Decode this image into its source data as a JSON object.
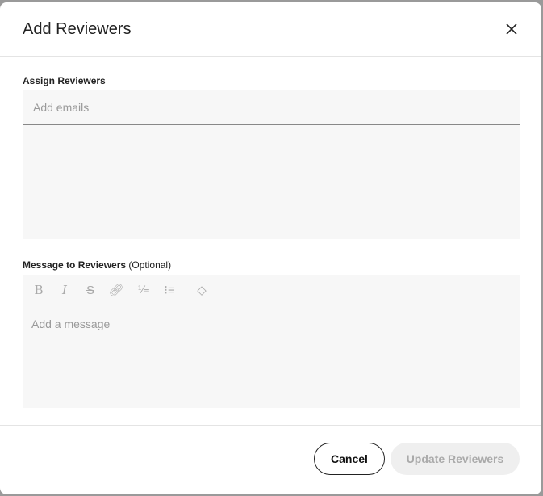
{
  "dialog": {
    "title": "Add Reviewers",
    "close_icon": "close-icon"
  },
  "assign": {
    "label": "Assign Reviewers",
    "placeholder": "Add emails"
  },
  "message": {
    "label": "Message to Reviewers",
    "optional": "(Optional)",
    "placeholder": "Add a message",
    "toolbar": [
      "bold-icon",
      "italic-icon",
      "strikethrough-icon",
      "link-icon",
      "ordered-list-icon",
      "bullet-list-icon",
      "eraser-icon"
    ]
  },
  "footer": {
    "cancel": "Cancel",
    "update": "Update Reviewers"
  }
}
